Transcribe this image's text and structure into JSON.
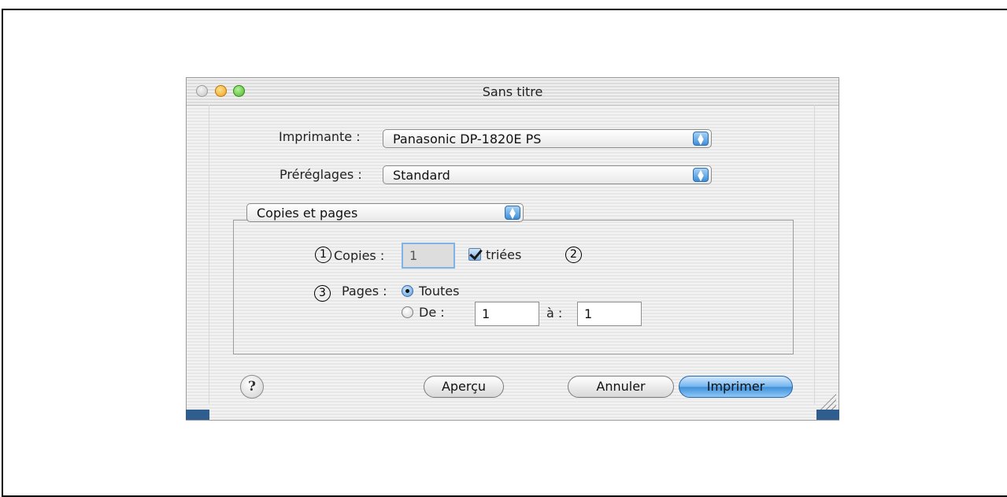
{
  "window": {
    "title": "Sans titre"
  },
  "printer": {
    "label": "Imprimante :",
    "value": "Panasonic DP-1820E PS"
  },
  "presets": {
    "label": "Préréglages :",
    "value": "Standard"
  },
  "panel": {
    "value": "Copies et pages"
  },
  "copies": {
    "label": "Copies :",
    "value": "1",
    "collated_label": "triées",
    "collated_checked": true
  },
  "pages": {
    "label": "Pages :",
    "all_label": "Toutes",
    "all_selected": true,
    "range_label": "De :",
    "from_value": "1",
    "to_label": "à :",
    "to_value": "1"
  },
  "callouts": {
    "one": "1",
    "two": "2",
    "three": "3"
  },
  "buttons": {
    "help": "?",
    "preview": "Aperçu",
    "cancel": "Annuler",
    "print": "Imprimer"
  }
}
